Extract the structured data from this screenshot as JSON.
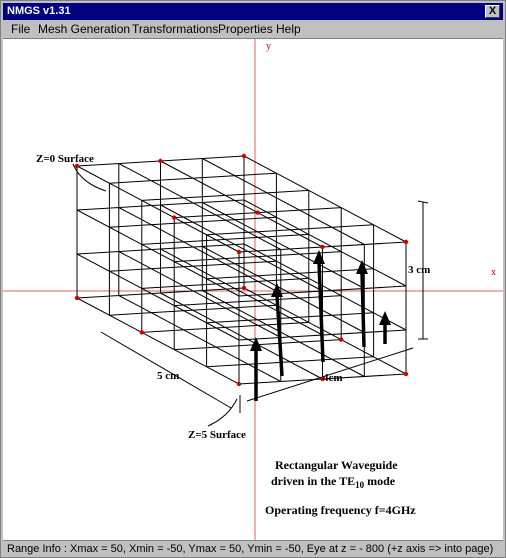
{
  "window": {
    "title": "NMGS v1.31",
    "close_label": "X"
  },
  "menu": [
    {
      "label": "File"
    },
    {
      "label": "Mesh Generation"
    },
    {
      "label": "Transformations"
    },
    {
      "label": "Properties"
    },
    {
      "label": "Help"
    }
  ],
  "canvas": {
    "axis_y_label": "y",
    "axis_x_label": "x",
    "z0_label": "Z=0  Surface",
    "z5_label": "Z=5  Surface",
    "width_label": "5 cm",
    "length_label": "4cm",
    "height_label": "3 cm",
    "caption_line1": "Rectangular Waveguide",
    "caption_line2_pre": "driven in the TE",
    "caption_line2_sub": "10",
    "caption_line2_post": " mode",
    "caption_line3": "Operating frequency f=4GHz",
    "colors": {
      "axis": "#c00000",
      "grid": "#000000",
      "node": "#d00000"
    }
  },
  "status": {
    "text": "Range Info : Xmax = 50, Xmin = -50, Ymax = 50, Ymin = -50, Eye at z = - 800 (+z axis => into page)"
  }
}
